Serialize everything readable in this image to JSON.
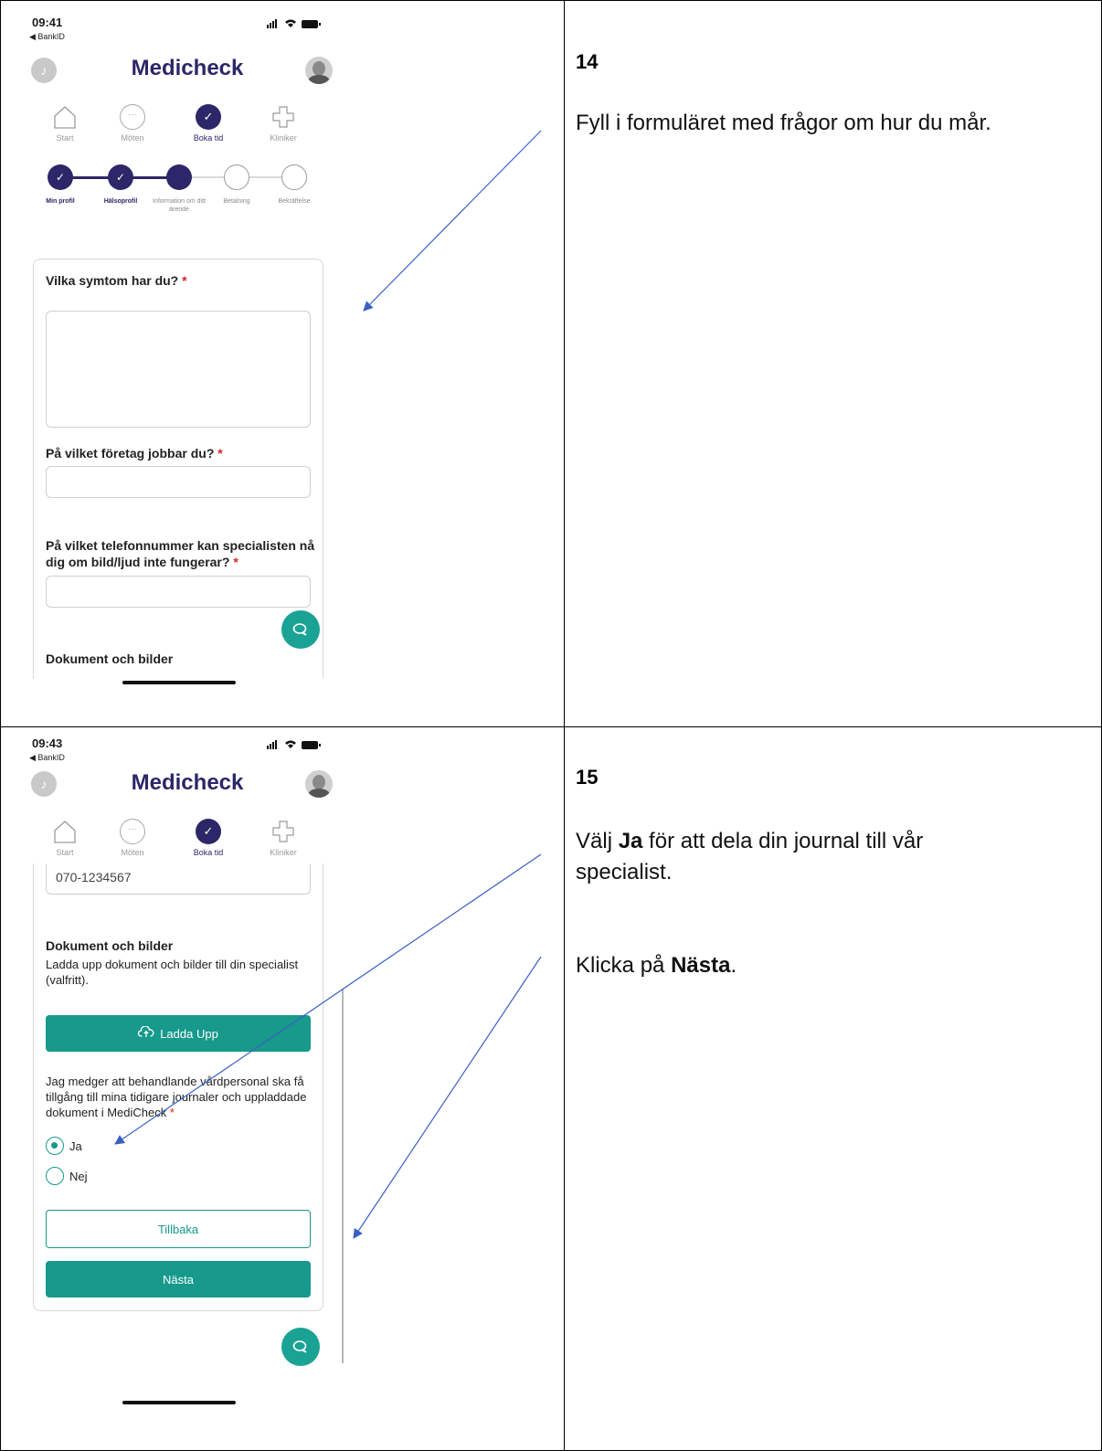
{
  "panel14": {
    "status_time": "09:41",
    "status_back": "◀ BankID",
    "status_icons": "..ıl ᯤ ▬",
    "brand": "Medicheck",
    "nav": [
      {
        "label": "Start"
      },
      {
        "label": "Möten"
      },
      {
        "label": "Boka tid"
      },
      {
        "label": "Kliniker"
      }
    ],
    "steps": [
      {
        "label": "Min profil"
      },
      {
        "label": "Hälsoprofil"
      },
      {
        "label": "Information om ditt ärende"
      },
      {
        "label": "Betalning"
      },
      {
        "label": "Bekräftelse"
      }
    ],
    "q1": "Vilka symtom har du?",
    "q2": "På vilket företag jobbar du?",
    "q3": "På vilket telefonnummer kan specialisten nå dig om bild/ljud inte fungerar?",
    "required_mark": "*",
    "docs_heading": "Dokument och bilder",
    "step_number": "14",
    "instruction": "Fyll i formuläret med frågor om hur du mår."
  },
  "panel15": {
    "status_time": "09:43",
    "status_back": "◀ BankID",
    "status_icons": "..ıl ᯤ ▬",
    "brand": "Medicheck",
    "nav": [
      {
        "label": "Start"
      },
      {
        "label": "Möten"
      },
      {
        "label": "Boka tid"
      },
      {
        "label": "Kliniker"
      }
    ],
    "phone_value": "070-1234567",
    "docs_heading": "Dokument och bilder",
    "docs_text": "Ladda upp dokument och bilder till din specialist (valfritt).",
    "upload_label": "Ladda Upp",
    "consent_text": "Jag medger att behandlande vårdpersonal ska få tillgång till mina tidigare journaler och uppladdade dokument i MediCheck",
    "required_mark": "*",
    "radio_yes": "Ja",
    "radio_no": "Nej",
    "back_label": "Tillbaka",
    "next_label": "Nästa",
    "step_number": "15",
    "instr1_pre": "Välj ",
    "instr1_bold": "Ja",
    "instr1_post": " för att dela din journal till vår specialist.",
    "instr2_pre": "Klicka på ",
    "instr2_bold": "Nästa",
    "instr2_post": "."
  },
  "icons": {
    "bell": "bell-icon",
    "home": "home-icon",
    "chat": "chat-bubble-icon",
    "check": "check-icon",
    "clinic": "cross-icon",
    "upload": "cloud-upload-icon"
  },
  "colors": {
    "brand": "#2d2668",
    "teal": "#17998b",
    "arrow": "#3b5fc0"
  }
}
